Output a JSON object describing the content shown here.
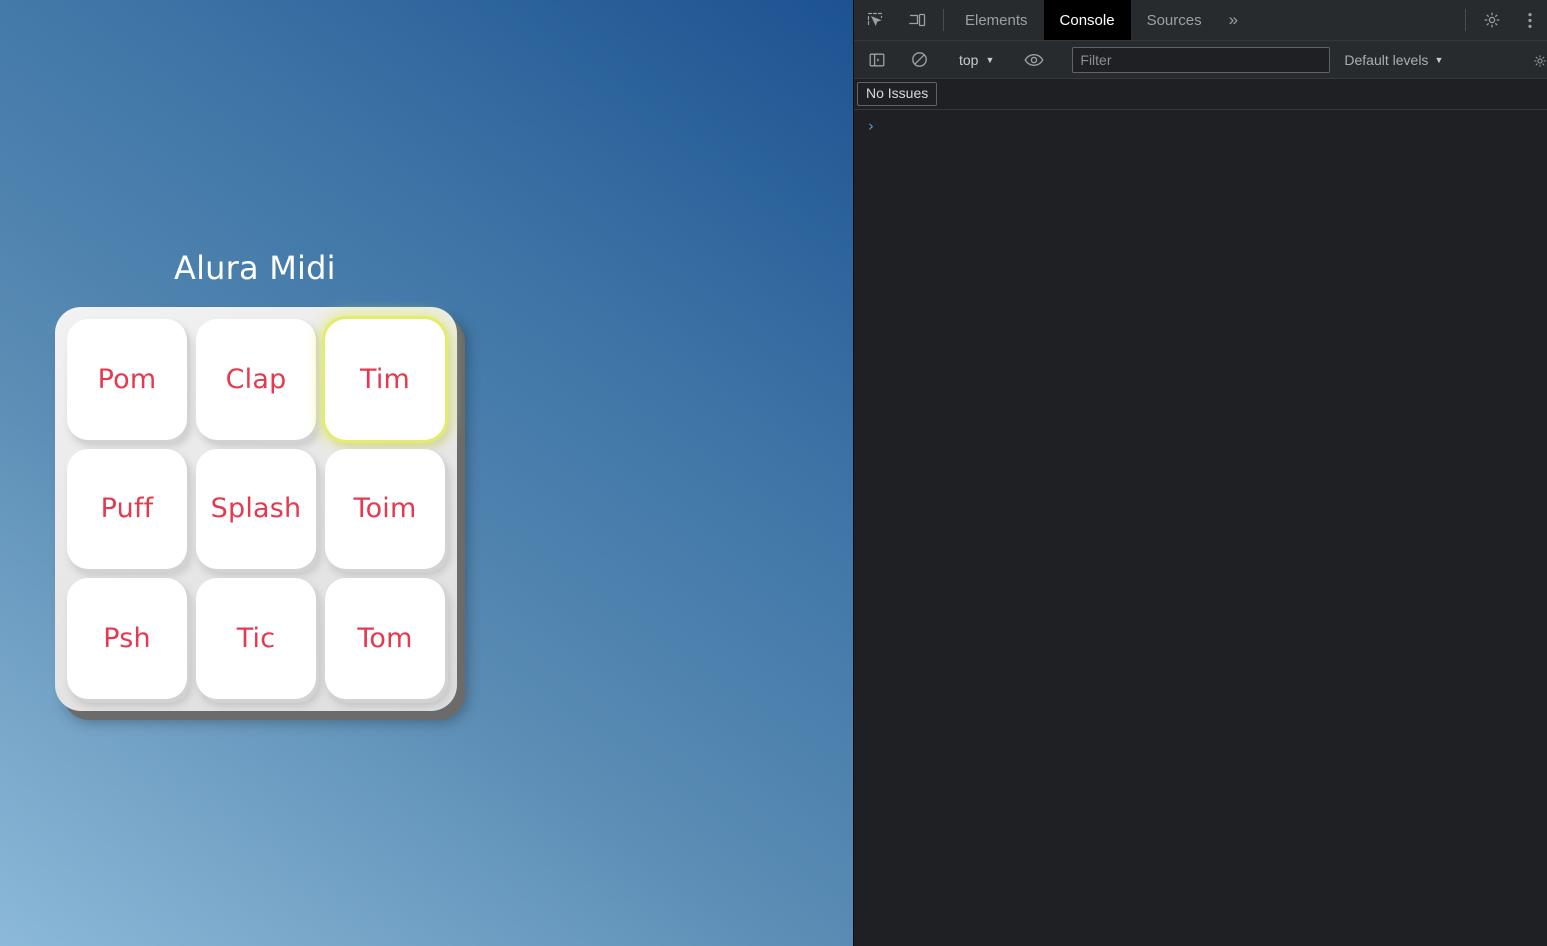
{
  "page": {
    "title": "Alura Midi",
    "background": {
      "from": "#1c5291",
      "to": "#8cb9d8"
    },
    "pad_text_color": "#e63950",
    "focus_glow_color": "#e3ec6e",
    "pads": [
      {
        "label": "Pom",
        "focused": false
      },
      {
        "label": "Clap",
        "focused": false
      },
      {
        "label": "Tim",
        "focused": true
      },
      {
        "label": "Puff",
        "focused": false
      },
      {
        "label": "Splash",
        "focused": false
      },
      {
        "label": "Toim",
        "focused": false
      },
      {
        "label": "Psh",
        "focused": false
      },
      {
        "label": "Tic",
        "focused": false
      },
      {
        "label": "Tom",
        "focused": false
      }
    ]
  },
  "devtools": {
    "tabbar": {
      "inspect_icon": "inspect-element-icon",
      "device_icon": "device-toolbar-icon",
      "tabs": [
        {
          "label": "Elements",
          "active": false
        },
        {
          "label": "Console",
          "active": true
        },
        {
          "label": "Sources",
          "active": false
        }
      ],
      "more_tabs_label": "»",
      "settings_icon": "gear-icon",
      "menu_icon": "vertical-dots-icon"
    },
    "console_toolbar": {
      "sidebar_icon": "console-sidebar-icon",
      "clear_icon": "clear-console-icon",
      "context": "top",
      "context_caret": "▼",
      "eye_icon": "live-expression-eye-icon",
      "filter_placeholder": "Filter",
      "filter_value": "",
      "levels_label": "Default levels",
      "levels_caret": "▼",
      "settings_icon": "console-settings-gear-icon"
    },
    "issues_bar": {
      "label": "No Issues"
    },
    "console_body": {
      "prompt_chevron": "›",
      "prompt_value": ""
    }
  }
}
